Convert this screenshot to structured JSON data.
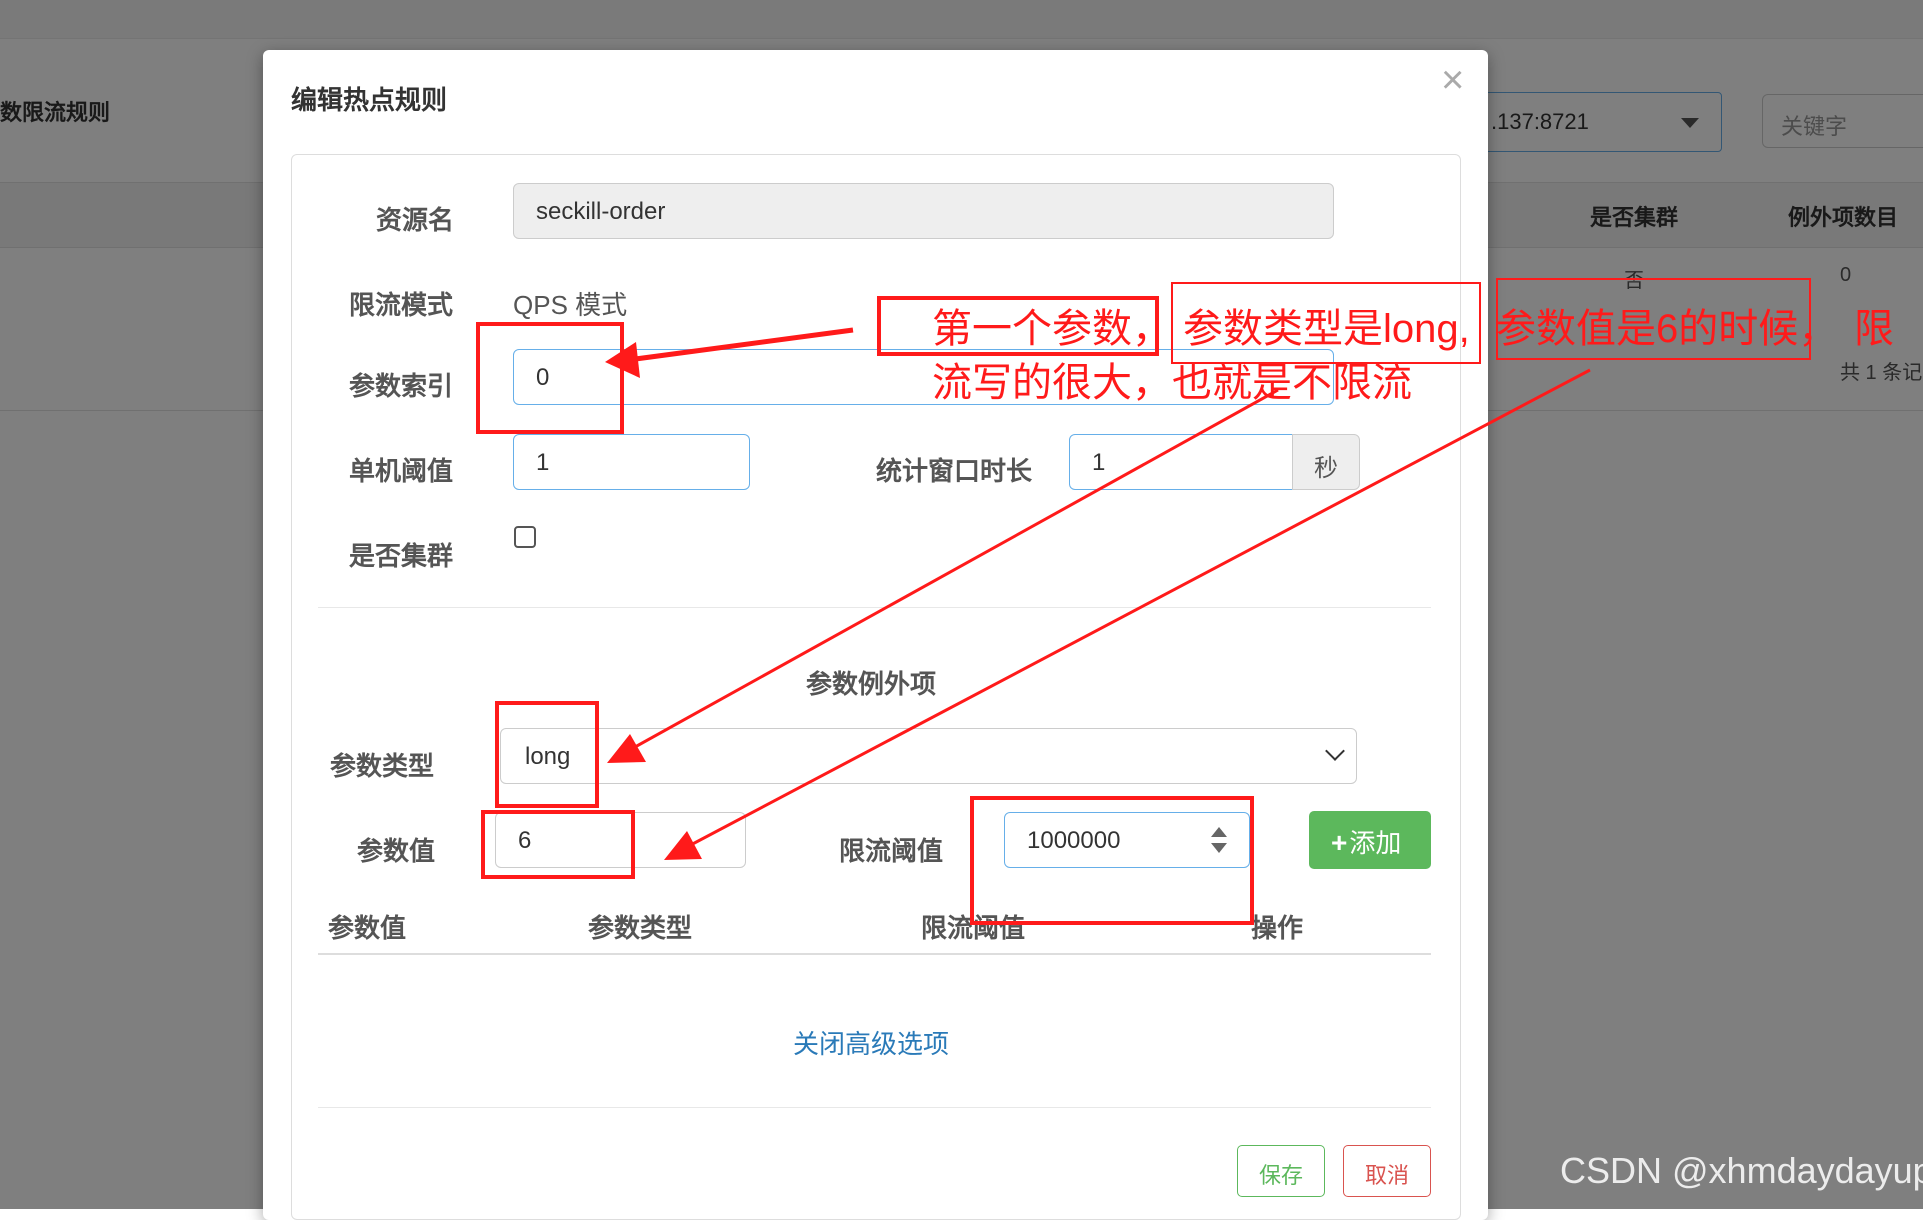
{
  "background": {
    "page_title": "数限流规则",
    "machine_select": ".137:8721",
    "search_placeholder": "关键字",
    "columns": [
      "是否集群",
      "例外项数目"
    ],
    "row": {
      "cluster": "否",
      "exception_count": "0"
    },
    "pagination": "共 1 条记"
  },
  "modal": {
    "title": "编辑热点规则",
    "close": "×",
    "resource_label": "资源名",
    "resource_value": "seckill-order",
    "mode_label": "限流模式",
    "mode_value": "QPS 模式",
    "param_index_label": "参数索引",
    "param_index_value": "0",
    "threshold_label": "单机阈值",
    "threshold_value": "1",
    "window_label": "统计窗口时长",
    "window_value": "1",
    "window_unit": "秒",
    "cluster_label": "是否集群",
    "exception_section_title": "参数例外项",
    "param_type_label": "参数类型",
    "param_type_value": "long",
    "param_value_label": "参数值",
    "param_value_value": "6",
    "limit_label": "限流阈值",
    "limit_value": "1000000",
    "add_button": "添加",
    "table_headers": [
      "参数值",
      "参数类型",
      "限流阈值",
      "操作"
    ],
    "advanced_link": "关闭高级选项",
    "save_button": "保存",
    "cancel_button": "取消"
  },
  "annotation": {
    "line1_a": "第一个参数，",
    "line1_b": "参数类型是long,",
    "line1_c": "参数值是6的时候，",
    "line1_d": "限",
    "line2": "流写的很大，也就是不限流",
    "color": "#ff1a1a"
  },
  "watermark": "CSDN @xhmdaydayup"
}
